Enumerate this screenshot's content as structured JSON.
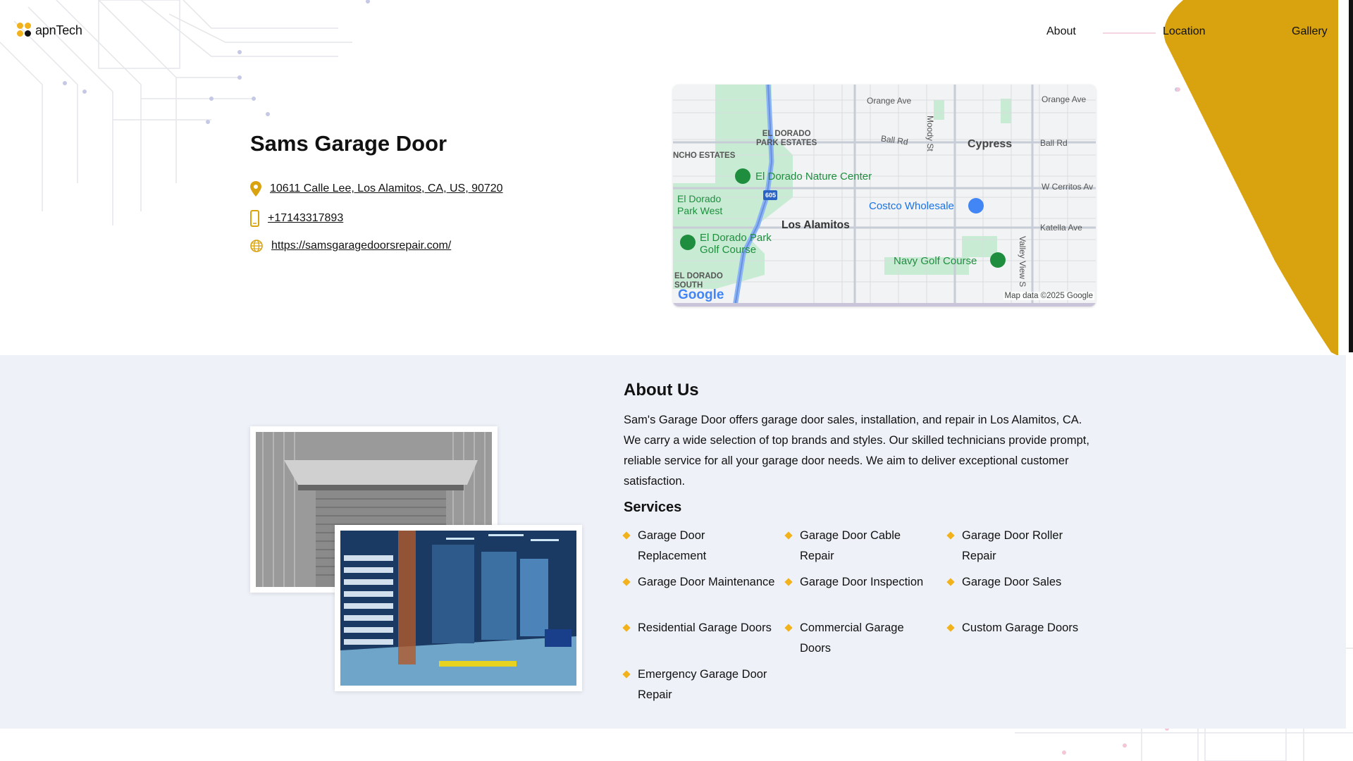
{
  "brand": {
    "logo_text": "apnTech",
    "dot_colors": [
      "#f2b21c",
      "#f2b21c",
      "#f2b21c",
      "#111111"
    ],
    "accent": "#d9a20f"
  },
  "nav": {
    "items": [
      {
        "label": "About"
      },
      {
        "label": "Location"
      },
      {
        "label": "Gallery"
      }
    ]
  },
  "business": {
    "name": "Sams Garage Door",
    "address": "10611 Calle Lee, Los Alamitos, CA, US, 90720",
    "phone": "+17143317893",
    "website": "https://samsgaragedoorsrepair.com/"
  },
  "icons": {
    "address": "map-pin-icon",
    "phone": "phone-icon",
    "website": "globe-icon"
  },
  "map": {
    "labels": {
      "orange_ave_1": "Orange Ave",
      "orange_ave_2": "Orange Ave",
      "moody_st": "Moody St",
      "el_dorado_park_estates": "EL DORADO\nPARK ESTATES",
      "ball_rd_1": "Ball Rd",
      "cypress": "Cypress",
      "ball_rd_2": "Ball Rd",
      "rancho_estates": "NCHO ESTATES",
      "el_dorado_nature_center": "El Dorado Nature Center",
      "w_cerritos": "W Cerritos Av",
      "el_dorado_park_west": "El Dorado\nPark West",
      "highway": "605",
      "costco": "Costco Wholesale",
      "los_alamitos": "Los Alamitos",
      "katella_ave": "Katella Ave",
      "el_dorado_park_golf": "El Dorado Park\nGolf Course",
      "navy_golf": "Navy Golf Course",
      "valley_view": "Valley View S",
      "el_dorado_south": "EL DORADO\nSOUTH",
      "google": "Google",
      "attribution": "Map data ©2025 Google"
    }
  },
  "about": {
    "title": "About Us",
    "text": "Sam's Garage Door offers garage door sales, installation, and repair in Los Alamitos, CA. We carry a wide selection of top brands and styles. Our skilled technicians provide prompt, reliable service for all your garage door needs. We aim to deliver exceptional customer satisfaction.",
    "services_title": "Services",
    "services": [
      "Garage Door Replacement",
      "Garage Door Cable Repair",
      "Garage Door Roller Repair",
      "Garage Door Maintenance",
      "Garage Door Inspection",
      "Garage Door Sales",
      "Residential Garage Doors",
      "Commercial Garage Doors",
      "Custom Garage Doors",
      "Emergency Garage Door Repair"
    ]
  }
}
